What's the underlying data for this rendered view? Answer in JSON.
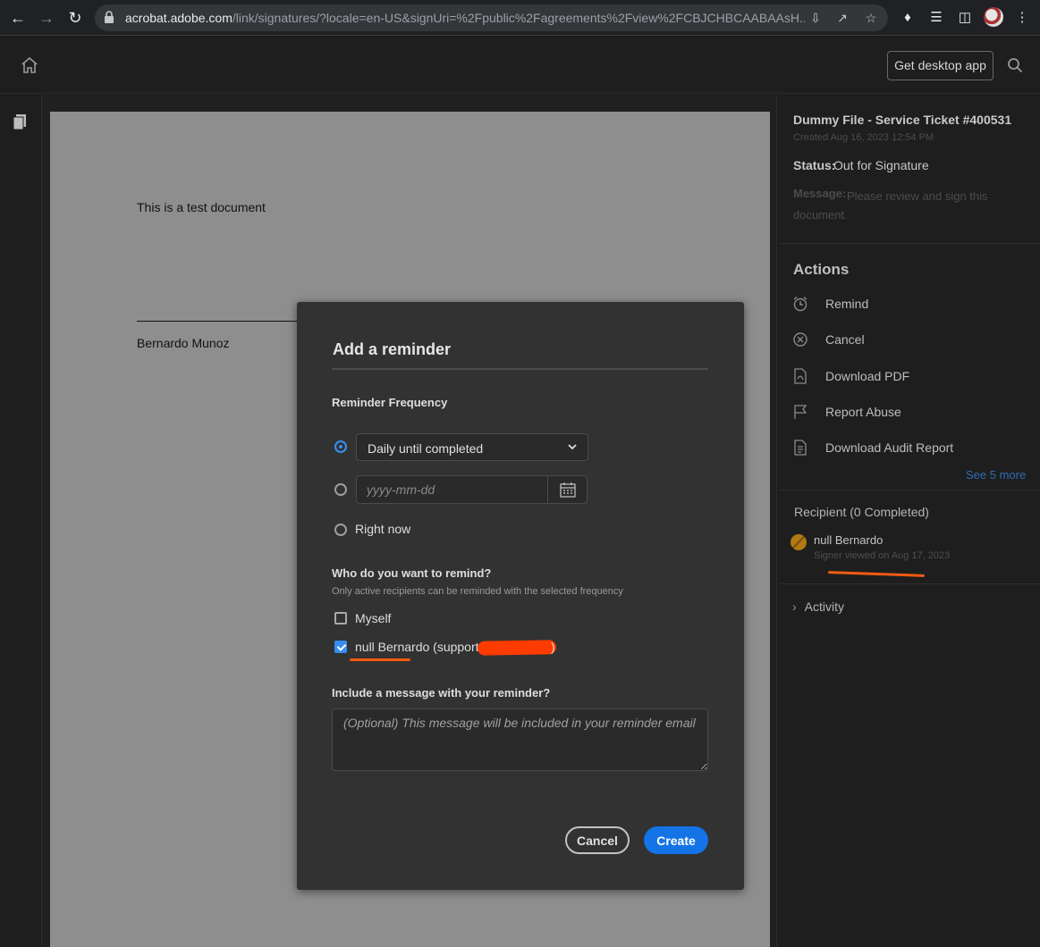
{
  "browser": {
    "url_host": "acrobat.adobe.com",
    "url_path": "/link/signatures/?locale=en-US&signUri=%2Fpublic%2Fagreements%2Fview%2FCBJCHBCAABAAsH..."
  },
  "header": {
    "get_desktop_app": "Get desktop app"
  },
  "document": {
    "body_text": "This is a test document",
    "signer_name": "Bernardo Munoz"
  },
  "panel": {
    "title": "Dummy File - Service Ticket #400531",
    "created": "Created Aug 16, 2023 12:54 PM",
    "status_label": "Status:",
    "status_value": "Out for Signature",
    "message_label": "Message:",
    "message_value": "Please review and sign this document.",
    "actions_title": "Actions",
    "actions": [
      {
        "label": "Remind",
        "icon": "alarm-clock-icon"
      },
      {
        "label": "Cancel",
        "icon": "cancel-circle-icon"
      },
      {
        "label": "Download PDF",
        "icon": "download-pdf-icon"
      },
      {
        "label": "Report Abuse",
        "icon": "flag-icon"
      },
      {
        "label": "Download Audit Report",
        "icon": "audit-report-icon"
      }
    ],
    "see_more": "See 5 more",
    "recipient_title": "Recipient (0 Completed)",
    "recipient_name": "null Bernardo",
    "recipient_sub": "Signer viewed on Aug 17, 2023",
    "activity": "Activity"
  },
  "modal": {
    "title": "Add a reminder",
    "frequency_label": "Reminder Frequency",
    "frequency_selected": "Daily until completed",
    "date_placeholder": "yyyy-mm-dd",
    "right_now": "Right now",
    "who_label": "Who do you want to remind?",
    "who_hint": "Only active recipients can be reminded with the selected frequency",
    "myself": "Myself",
    "recipient_option": "null Bernardo (support@",
    "recipient_option_end": ")",
    "message_label": "Include a message with your reminder?",
    "message_placeholder": "(Optional) This message will be included in your reminder email",
    "cancel": "Cancel",
    "create": "Create"
  },
  "colors": {
    "accent": "#1473e6",
    "annotation": "#f05a12"
  }
}
